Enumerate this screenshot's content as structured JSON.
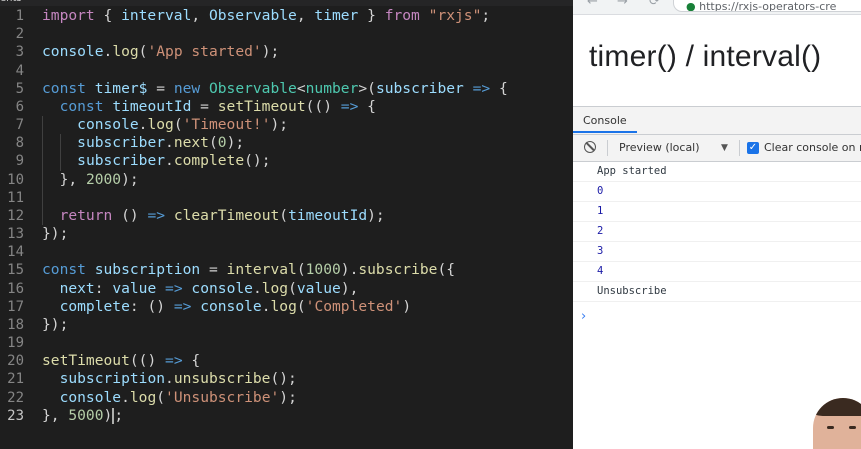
{
  "editor": {
    "top_label": "ents",
    "lines": [
      {
        "n": "1",
        "tokens": [
          {
            "t": "import",
            "c": "kw"
          },
          {
            "t": " { "
          },
          {
            "t": "interval",
            "c": "vr"
          },
          {
            "t": ", "
          },
          {
            "t": "Observable",
            "c": "vr"
          },
          {
            "t": ", "
          },
          {
            "t": "timer",
            "c": "vr"
          },
          {
            "t": " } "
          },
          {
            "t": "from",
            "c": "kw"
          },
          {
            "t": " "
          },
          {
            "t": "\"rxjs\"",
            "c": "st"
          },
          {
            "t": ";"
          }
        ]
      },
      {
        "n": "2",
        "tokens": []
      },
      {
        "n": "3",
        "tokens": [
          {
            "t": "console",
            "c": "vr"
          },
          {
            "t": "."
          },
          {
            "t": "log",
            "c": "fn"
          },
          {
            "t": "("
          },
          {
            "t": "'App started'",
            "c": "st"
          },
          {
            "t": ");"
          }
        ]
      },
      {
        "n": "4",
        "tokens": []
      },
      {
        "n": "5",
        "tokens": [
          {
            "t": "const",
            "c": "bl"
          },
          {
            "t": " "
          },
          {
            "t": "timer$",
            "c": "vr"
          },
          {
            "t": " = "
          },
          {
            "t": "new",
            "c": "bl"
          },
          {
            "t": " "
          },
          {
            "t": "Observable",
            "c": "ty"
          },
          {
            "t": "<"
          },
          {
            "t": "number",
            "c": "ty"
          },
          {
            "t": ">("
          },
          {
            "t": "subscriber",
            "c": "vr"
          },
          {
            "t": " "
          },
          {
            "t": "=>",
            "c": "bl"
          },
          {
            "t": " {"
          }
        ]
      },
      {
        "n": "6",
        "tokens": [
          {
            "t": "  "
          },
          {
            "t": "const",
            "c": "bl"
          },
          {
            "t": " "
          },
          {
            "t": "timeoutId",
            "c": "vr"
          },
          {
            "t": " = "
          },
          {
            "t": "setTimeout",
            "c": "fn"
          },
          {
            "t": "(() "
          },
          {
            "t": "=>",
            "c": "bl"
          },
          {
            "t": " {"
          }
        ]
      },
      {
        "n": "7",
        "tokens": [
          {
            "t": "    "
          },
          {
            "t": "console",
            "c": "vr"
          },
          {
            "t": "."
          },
          {
            "t": "log",
            "c": "fn"
          },
          {
            "t": "("
          },
          {
            "t": "'Timeout!'",
            "c": "st"
          },
          {
            "t": ");"
          }
        ]
      },
      {
        "n": "8",
        "tokens": [
          {
            "t": "    "
          },
          {
            "t": "subscriber",
            "c": "vr"
          },
          {
            "t": "."
          },
          {
            "t": "next",
            "c": "fn"
          },
          {
            "t": "("
          },
          {
            "t": "0",
            "c": "nm"
          },
          {
            "t": ");"
          }
        ]
      },
      {
        "n": "9",
        "tokens": [
          {
            "t": "    "
          },
          {
            "t": "subscriber",
            "c": "vr"
          },
          {
            "t": "."
          },
          {
            "t": "complete",
            "c": "fn"
          },
          {
            "t": "();"
          }
        ]
      },
      {
        "n": "10",
        "tokens": [
          {
            "t": "  }, "
          },
          {
            "t": "2000",
            "c": "nm"
          },
          {
            "t": ");"
          }
        ]
      },
      {
        "n": "11",
        "tokens": []
      },
      {
        "n": "12",
        "tokens": [
          {
            "t": "  "
          },
          {
            "t": "return",
            "c": "kw"
          },
          {
            "t": " () "
          },
          {
            "t": "=>",
            "c": "bl"
          },
          {
            "t": " "
          },
          {
            "t": "clearTimeout",
            "c": "fn"
          },
          {
            "t": "("
          },
          {
            "t": "timeoutId",
            "c": "vr"
          },
          {
            "t": ");"
          }
        ]
      },
      {
        "n": "13",
        "tokens": [
          {
            "t": "});"
          }
        ]
      },
      {
        "n": "14",
        "tokens": []
      },
      {
        "n": "15",
        "tokens": [
          {
            "t": "const",
            "c": "bl"
          },
          {
            "t": " "
          },
          {
            "t": "subscription",
            "c": "vr"
          },
          {
            "t": " = "
          },
          {
            "t": "interval",
            "c": "fn"
          },
          {
            "t": "("
          },
          {
            "t": "1000",
            "c": "nm"
          },
          {
            "t": ")."
          },
          {
            "t": "subscribe",
            "c": "fn"
          },
          {
            "t": "({"
          }
        ]
      },
      {
        "n": "16",
        "tokens": [
          {
            "t": "  "
          },
          {
            "t": "next",
            "c": "vr"
          },
          {
            "t": ": "
          },
          {
            "t": "value",
            "c": "vr"
          },
          {
            "t": " "
          },
          {
            "t": "=>",
            "c": "bl"
          },
          {
            "t": " "
          },
          {
            "t": "console",
            "c": "vr"
          },
          {
            "t": "."
          },
          {
            "t": "log",
            "c": "fn"
          },
          {
            "t": "("
          },
          {
            "t": "value",
            "c": "vr"
          },
          {
            "t": "),"
          }
        ]
      },
      {
        "n": "17",
        "tokens": [
          {
            "t": "  "
          },
          {
            "t": "complete",
            "c": "vr"
          },
          {
            "t": ": () "
          },
          {
            "t": "=>",
            "c": "bl"
          },
          {
            "t": " "
          },
          {
            "t": "console",
            "c": "vr"
          },
          {
            "t": "."
          },
          {
            "t": "log",
            "c": "fn"
          },
          {
            "t": "("
          },
          {
            "t": "'Completed'",
            "c": "st"
          },
          {
            "t": ")"
          }
        ]
      },
      {
        "n": "18",
        "tokens": [
          {
            "t": "});"
          }
        ]
      },
      {
        "n": "19",
        "tokens": []
      },
      {
        "n": "20",
        "tokens": [
          {
            "t": "setTimeout",
            "c": "fn"
          },
          {
            "t": "(() "
          },
          {
            "t": "=>",
            "c": "bl"
          },
          {
            "t": " {"
          }
        ]
      },
      {
        "n": "21",
        "tokens": [
          {
            "t": "  "
          },
          {
            "t": "subscription",
            "c": "vr"
          },
          {
            "t": "."
          },
          {
            "t": "unsubscribe",
            "c": "fn"
          },
          {
            "t": "();"
          }
        ]
      },
      {
        "n": "22",
        "tokens": [
          {
            "t": "  "
          },
          {
            "t": "console",
            "c": "vr"
          },
          {
            "t": "."
          },
          {
            "t": "log",
            "c": "fn"
          },
          {
            "t": "("
          },
          {
            "t": "'Unsubscribe'",
            "c": "st"
          },
          {
            "t": ");"
          }
        ]
      },
      {
        "n": "23",
        "tokens": [
          {
            "t": "}, "
          },
          {
            "t": "5000",
            "c": "nm"
          },
          {
            "t": ")"
          },
          {
            "t": "",
            "cursor": true
          },
          {
            "t": ";"
          }
        ],
        "active": true
      }
    ]
  },
  "browser": {
    "url": "https://rxjs-operators-cre",
    "page_title": "timer() / interval()",
    "devtools": {
      "tab_label": "Console",
      "context": "Preview (local)",
      "clear_on_reload_label": "Clear console on re",
      "clear_on_reload_checked": true,
      "messages": [
        {
          "text": "App started",
          "kind": "log"
        },
        {
          "text": "0",
          "kind": "num"
        },
        {
          "text": "1",
          "kind": "num"
        },
        {
          "text": "2",
          "kind": "num"
        },
        {
          "text": "3",
          "kind": "num"
        },
        {
          "text": "4",
          "kind": "num"
        },
        {
          "text": "Unsubscribe",
          "kind": "log"
        }
      ],
      "prompt_glyph": "›"
    }
  },
  "icons": {
    "back": "back-arrow-icon",
    "forward": "forward-arrow-icon",
    "reload": "reload-icon",
    "clear": "clear-console-icon",
    "dropdown": "chevron-down-icon",
    "checkbox": "checkmark-icon",
    "prompt": "prompt-chevron-icon",
    "presenter": "presenter-avatar"
  }
}
